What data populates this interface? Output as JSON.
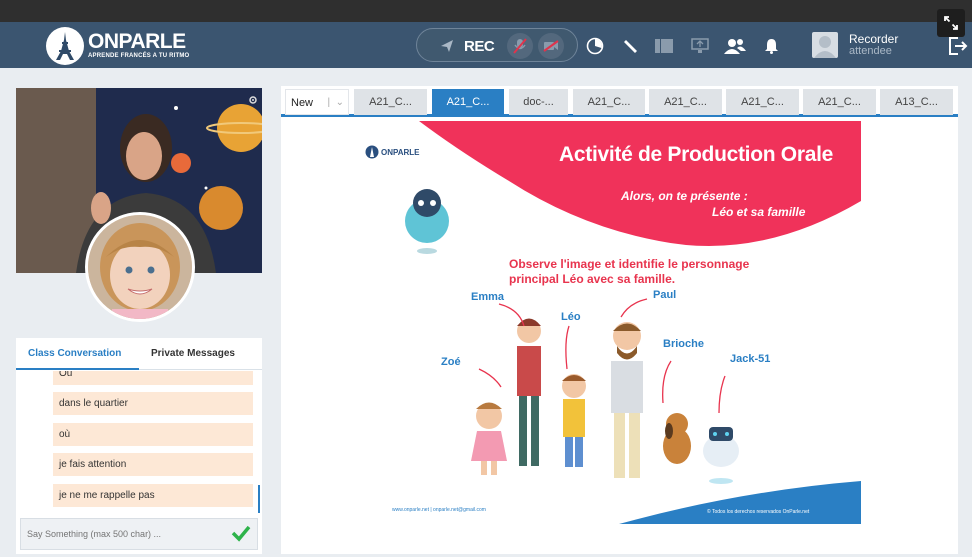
{
  "header": {
    "brand": "ONPARLE",
    "tagline": "APRENDE FRANCÉS A TU RITMO",
    "rec_label": "REC",
    "user_name": "Recorder",
    "user_role": "attendee",
    "icons": [
      "pointer-icon",
      "mic-muted-icon",
      "camera-muted-icon",
      "timer-icon",
      "hand-raise-icon",
      "layout-icon",
      "screen-share-icon",
      "users-icon",
      "bell-icon",
      "logout-icon",
      "fullscreen-icon"
    ]
  },
  "chat": {
    "tab_class": "Class Conversation",
    "tab_private": "Private Messages",
    "messages": [
      "Ou",
      "dans le quartier",
      "où",
      "je fais attention",
      "je ne me rappelle pas"
    ],
    "input_placeholder": "Say Something (max 500 char) ..."
  },
  "board": {
    "new_label": "New",
    "tabs": [
      "A21_C...",
      "A21_C...",
      "doc-...",
      "A21_C...",
      "A21_C...",
      "A21_C...",
      "A21_C...",
      "A13_C..."
    ],
    "active_tab_index": 1
  },
  "slide": {
    "logo": "ONPARLE",
    "logo_tag": "APRENDE FRANCÉS A TU RITMO",
    "title": "Activité de Production Orale",
    "subtitle1": "Alors, on te présente :",
    "subtitle2": "Léo et sa famille",
    "instruction": "Observe l'image et identifie le personnage principal Léo avec sa famille.",
    "names": {
      "emma": "Emma",
      "leo": "Léo",
      "paul": "Paul",
      "zoe": "Zoé",
      "brioche": "Brioche",
      "jack": "Jack-51"
    },
    "footer_left": "www.onparle.net  |  onparle.net@gmail.com",
    "footer_right": "© Todos los derechos reservados OnParle.net"
  },
  "colors": {
    "accent": "#2a7fc4",
    "header": "#3b5570",
    "slide_pink": "#f0325a",
    "chat_bubble": "#fde8d6",
    "send": "#2db34a"
  }
}
